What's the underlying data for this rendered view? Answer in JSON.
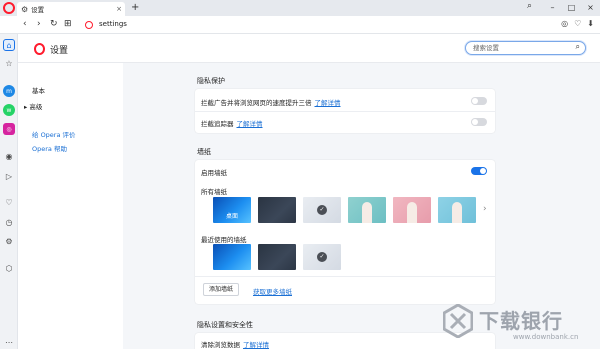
{
  "tab": {
    "title": "设置",
    "close": "×"
  },
  "new_tab": "+",
  "window_controls": [
    "–",
    "□",
    "×"
  ],
  "tabs_menu": "⌕",
  "nav": {
    "back": "‹",
    "forward": "›",
    "reload": "↻",
    "grid": "⊞"
  },
  "address": {
    "url": "settings"
  },
  "address_icons": [
    "◎",
    "♡",
    "⬇"
  ],
  "sidebar_icons": [
    "home-icon",
    "star-icon",
    "messenger-icon",
    "whatsapp-icon",
    "instagram-icon",
    "player-icon",
    "send-icon",
    "heart-icon",
    "clock-icon",
    "gear-icon",
    "extensions-icon",
    "more-icon"
  ],
  "settings": {
    "title": "设置",
    "search_placeholder": "搜索设置"
  },
  "left_nav": {
    "basic": "基本",
    "advanced": "▸ 高级",
    "rate": "给 Opera 评价",
    "help": "Opera 帮助"
  },
  "privacy": {
    "section_title": "隐私保护",
    "ads": {
      "label": "拦截广告并将浏览网页的速度提升三倍",
      "link": "了解详情",
      "enabled": false
    },
    "trackers": {
      "label": "拦截追踪器",
      "link": "了解详情",
      "enabled": false
    }
  },
  "wallpapers": {
    "section_title": "墙纸",
    "enable_label": "启用墙纸",
    "enabled": true,
    "all_label": "所有墙纸",
    "recent_label": "最近使用的墙纸",
    "first_caption": "桌面",
    "check": "✓",
    "next": "›",
    "add_button": "添加墙纸",
    "more_link": "获取更多墙纸"
  },
  "security": {
    "section_title": "隐私设置和安全性",
    "clear_label": "清除浏览数据",
    "clear_link": "了解详情"
  },
  "watermark": {
    "text": "下载银行",
    "url": "www.downbank.cn"
  },
  "colors": {
    "accent": "#1a73e8",
    "brand": "#ff1b2d",
    "link": "#1a6fd4"
  }
}
